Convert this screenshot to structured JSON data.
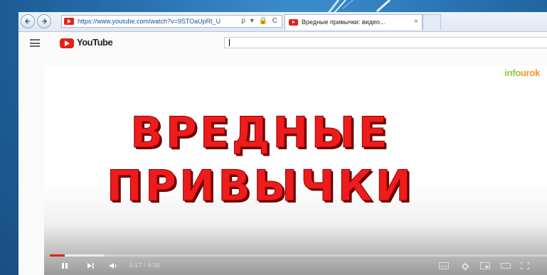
{
  "browser": {
    "url": "https://www.youtube.com/watch?v=9STOaUpRt_U",
    "address_icons": "ρ ▾ 🔒 C",
    "tab_title": "Вредные привычки: видео...",
    "tab_close": "×"
  },
  "youtube": {
    "logo_text": "YouTube",
    "search_value": ""
  },
  "video": {
    "watermark_part1": "info",
    "watermark_part2": "urok",
    "headline_line1": "ВРЕДНЫЕ",
    "headline_line2": "ПРИВЫЧКИ",
    "time_display": "0:17 / 9:35",
    "played_fraction": 0.03,
    "buffered_fraction": 0.11
  },
  "colors": {
    "youtube_red": "#e62117",
    "headline_red": "#ee1c1c",
    "slide_blue": "#2a74b5"
  }
}
